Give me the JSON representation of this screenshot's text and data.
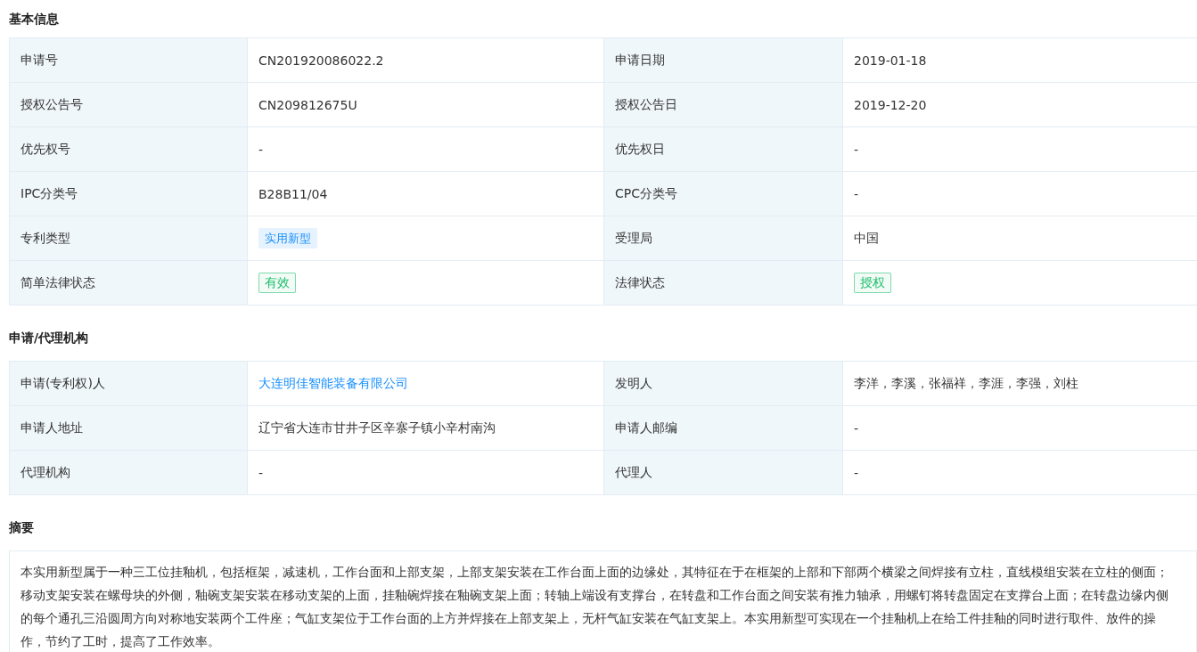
{
  "sections": [
    {
      "title": "基本信息",
      "kind": "table",
      "rows": [
        [
          {
            "label": "申请号",
            "value": {
              "kind": "text",
              "text": "CN201920086022.2"
            }
          },
          {
            "label": "申请日期",
            "value": {
              "kind": "text",
              "text": "2019-01-18"
            }
          }
        ],
        [
          {
            "label": "授权公告号",
            "value": {
              "kind": "text",
              "text": "CN209812675U"
            }
          },
          {
            "label": "授权公告日",
            "value": {
              "kind": "text",
              "text": "2019-12-20"
            }
          }
        ],
        [
          {
            "label": "优先权号",
            "value": {
              "kind": "text",
              "text": "-"
            }
          },
          {
            "label": "优先权日",
            "value": {
              "kind": "text",
              "text": "-"
            }
          }
        ],
        [
          {
            "label": "IPC分类号",
            "value": {
              "kind": "text",
              "text": "B28B11/04"
            }
          },
          {
            "label": "CPC分类号",
            "value": {
              "kind": "text",
              "text": "-"
            }
          }
        ],
        [
          {
            "label": "专利类型",
            "value": {
              "kind": "tag",
              "text": "实用新型",
              "color": "#1890ff"
            }
          },
          {
            "label": "受理局",
            "value": {
              "kind": "text",
              "text": "中国"
            }
          }
        ],
        [
          {
            "label": "简单法律状态",
            "value": {
              "kind": "tag",
              "text": "有效",
              "color": "#19be6b"
            }
          },
          {
            "label": "法律状态",
            "value": {
              "kind": "tag",
              "text": "授权",
              "color": "#19be6b"
            }
          }
        ]
      ]
    },
    {
      "title": "申请/代理机构",
      "kind": "table",
      "rows": [
        [
          {
            "label": "申请(专利权)人",
            "value": {
              "kind": "link",
              "text": "大连明佳智能装备有限公司"
            }
          },
          {
            "label": "发明人",
            "value": {
              "kind": "text",
              "text": "李洋，李溪，张福祥，李涯，李强，刘柱"
            }
          }
        ],
        [
          {
            "label": "申请人地址",
            "value": {
              "kind": "text",
              "text": "辽宁省大连市甘井子区辛寨子镇小辛村南沟"
            }
          },
          {
            "label": "申请人邮编",
            "value": {
              "kind": "text",
              "text": "-"
            }
          }
        ],
        [
          {
            "label": "代理机构",
            "value": {
              "kind": "text",
              "text": "-"
            }
          },
          {
            "label": "代理人",
            "value": {
              "kind": "text",
              "text": "-"
            }
          }
        ]
      ]
    },
    {
      "title": "摘要",
      "kind": "text",
      "text": "本实用新型属于一种三工位挂釉机，包括框架，减速机，工作台面和上部支架，上部支架安装在工作台面上面的边缘处，其特征在于在框架的上部和下部两个横梁之间焊接有立柱，直线模组安装在立柱的侧面；移动支架安装在螺母块的外侧，釉碗支架安装在移动支架的上面，挂釉碗焊接在釉碗支架上面；转轴上端设有支撑台，在转盘和工作台面之间安装有推力轴承，用螺钉将转盘固定在支撑台上面；在转盘边缘内侧的每个通孔三沿圆周方向对称地安装两个工件座；气缸支架位于工作台面的上方并焊接在上部支架上，无杆气缸安装在气缸支架上。本实用新型可实现在一个挂釉机上在给工件挂釉的同时进行取件、放件的操作，节约了工时，提高了工作效率。"
    }
  ]
}
